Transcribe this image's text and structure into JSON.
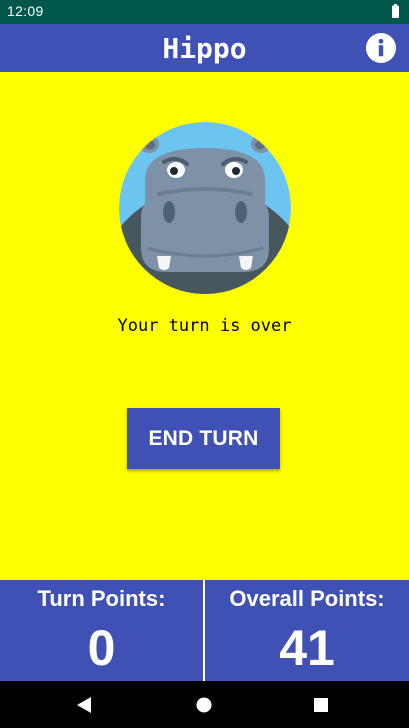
{
  "status_bar": {
    "time": "12:09",
    "battery_icon": "battery-icon"
  },
  "app_bar": {
    "title": "Hippo",
    "info_icon": "info-icon",
    "color": "#3f51b5"
  },
  "main": {
    "background_color": "#ffff00",
    "image": "hippo-avatar",
    "message": "Your turn is over",
    "end_turn_label": "END TURN"
  },
  "scores": {
    "turn_label": "Turn Points:",
    "turn_value": "0",
    "overall_label": "Overall Points:",
    "overall_value": "41"
  },
  "nav_bar": {
    "back_icon": "back-icon",
    "home_icon": "home-icon",
    "recents_icon": "recents-icon"
  }
}
